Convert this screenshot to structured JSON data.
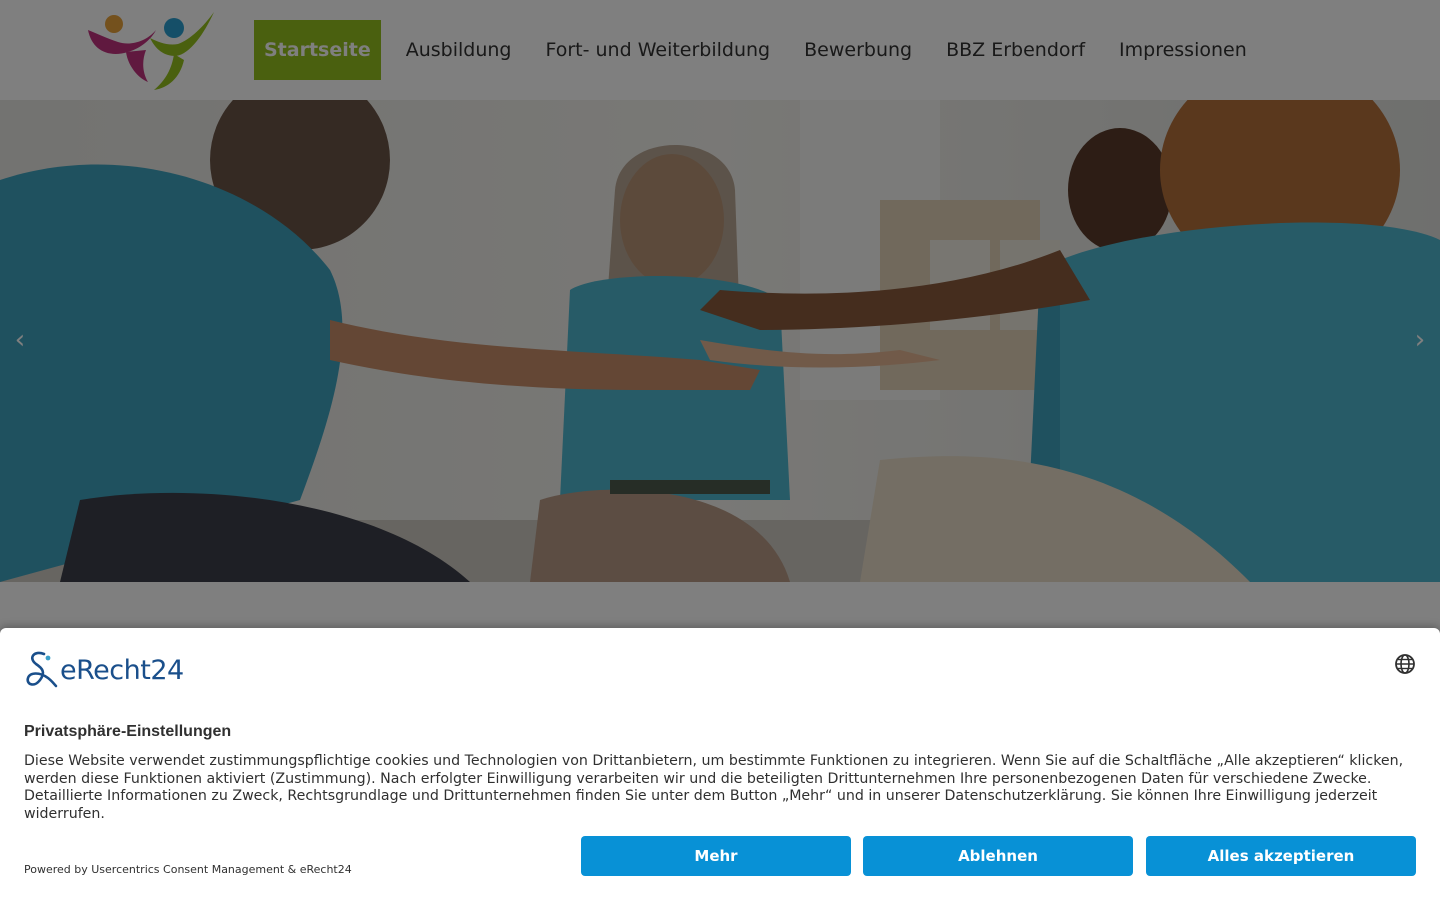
{
  "header": {
    "nav": [
      {
        "label": "Startseite",
        "active": true
      },
      {
        "label": "Ausbildung"
      },
      {
        "label": "Fort- und Weiterbildung"
      },
      {
        "label": "Bewerbung"
      },
      {
        "label": "BBZ Erbendorf"
      },
      {
        "label": "Impressionen"
      }
    ],
    "active_color": "#95c11f"
  },
  "hero": {
    "prev_icon": "chevron-left-icon",
    "next_icon": "chevron-right-icon",
    "prev_glyph": "‹",
    "next_glyph": "›"
  },
  "consent": {
    "brand": "eRecht24",
    "title": "Privatsphäre-Einstellungen",
    "text": "Diese Website verwendet zustimmungspflichtige cookies und Technologien von Drittanbietern, um bestimmte Funktionen zu integrieren. Wenn Sie auf die Schaltfläche „Alle akzeptieren“ klicken, werden diese Funktionen aktiviert (Zustimmung). Nach erfolgter Einwilligung verarbeiten wir und die beteiligten Drittunternehmen Ihre personenbezogenen Daten für verschiedene Zwecke. Detaillierte Informationen zu Zweck, Rechtsgrundlage und Drittunternehmen finden Sie unter dem Button „Mehr“ und in unserer Datenschutzerklärung. Sie können Ihre Einwilligung jederzeit widerrufen.",
    "powered_by": "Powered by Usercentrics Consent Management & eRecht24",
    "buttons": {
      "more": "Mehr",
      "deny": "Ablehnen",
      "accept": "Alles akzeptieren"
    },
    "button_color": "#0891d6",
    "language_icon": "globe-icon"
  }
}
